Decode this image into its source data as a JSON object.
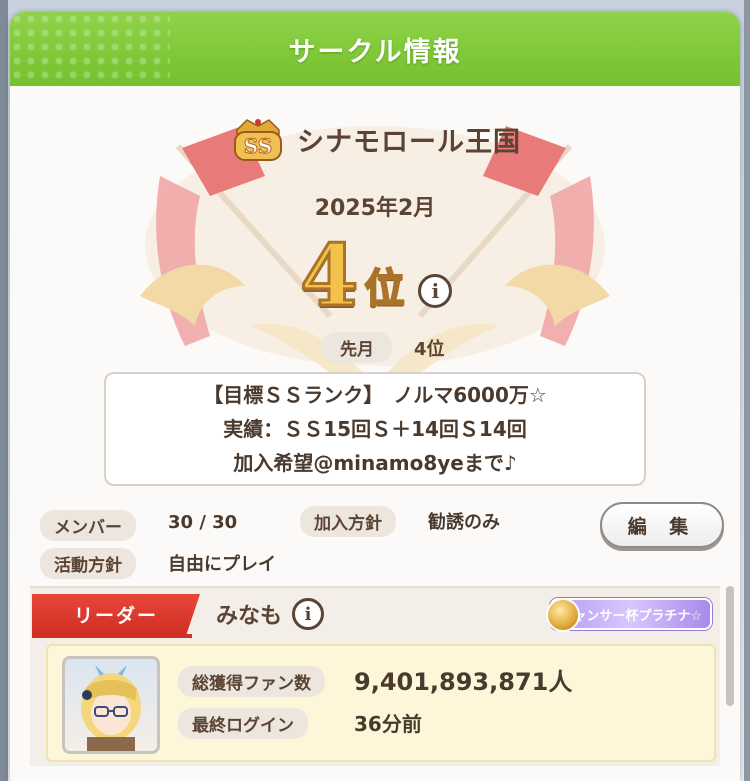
{
  "dialog": {
    "title": "サークル情報"
  },
  "circle": {
    "rank_badge": "SS",
    "name": "シナモロール王国",
    "period": "2025年2月",
    "rank_number": "4",
    "rank_suffix": "位",
    "info_icon": "i",
    "last_month_label": "先月",
    "last_month_value": "4位",
    "description": [
      "【目標ＳＳランク】　ノルマ6000万☆",
      "実績：ＳＳ15回Ｓ＋14回Ｓ14回",
      "加入希望@minamo8yeまで♪"
    ]
  },
  "properties": {
    "members_label": "メンバー",
    "members_value": "30 / 30",
    "join_policy_label": "加入方針",
    "join_policy_value": "勧誘のみ",
    "activity_label": "活動方針",
    "activity_value": "自由にプレイ"
  },
  "actions": {
    "edit_label": "編 集"
  },
  "leader": {
    "tag": "リーダー",
    "name": "みなも",
    "info_icon": "i",
    "title_badge": "キャンサー杯プラチナ☆",
    "fans_label": "総獲得ファン数",
    "fans_value": "9,401,893,871人",
    "login_label": "最終ログイン",
    "login_value": "36分前"
  },
  "icons": {
    "rank_badge": "ss-rank-crown-icon",
    "flags": "crossed-flags-icon",
    "medal": "medal-icon",
    "info": "info-icon"
  },
  "colors": {
    "title_bar": "#80c93b",
    "leader_tag": "#d9382c",
    "rank_gold": "#f2c24a",
    "text_brown": "#5b4434"
  }
}
